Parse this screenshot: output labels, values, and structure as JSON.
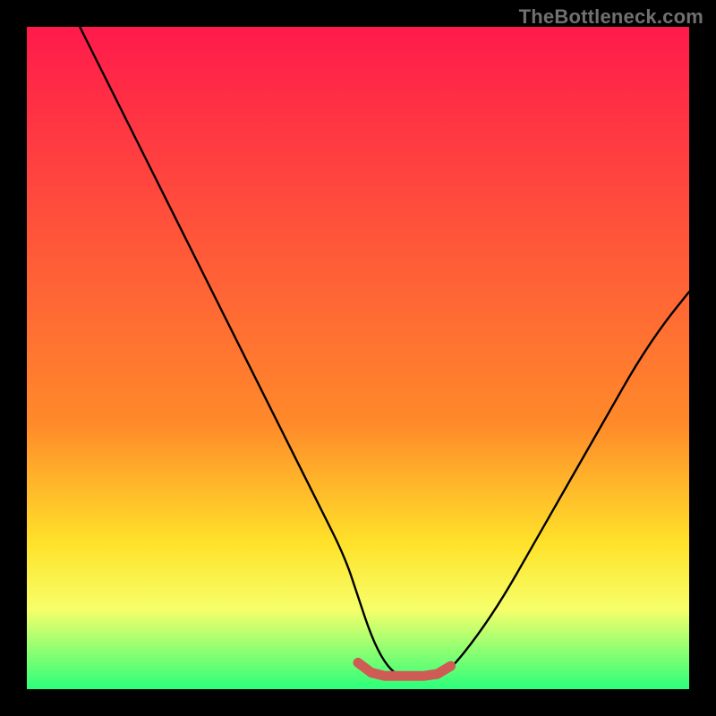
{
  "watermark": {
    "text": "TheBottleneck.com"
  },
  "colors": {
    "gradient_top": "#ff1a4b",
    "gradient_mid1": "#ff8a2a",
    "gradient_mid2": "#ffe22a",
    "gradient_mid3": "#f6ff6a",
    "gradient_bottom": "#2bff7a",
    "curve": "#000000",
    "marker": "#cf5b55",
    "frame": "#000000"
  },
  "chart_data": {
    "type": "line",
    "title": "",
    "xlabel": "",
    "ylabel": "",
    "xlim": [
      0,
      100
    ],
    "ylim": [
      0,
      100
    ],
    "series": [
      {
        "name": "bottleneck-curve",
        "x": [
          8,
          12,
          16,
          20,
          24,
          28,
          32,
          36,
          40,
          44,
          48,
          50,
          52,
          54,
          56,
          58,
          60,
          62,
          64,
          68,
          72,
          76,
          80,
          84,
          88,
          92,
          96,
          100
        ],
        "y": [
          100,
          92,
          84,
          76,
          68,
          60,
          52,
          44,
          36,
          28,
          20,
          14,
          8,
          4,
          2,
          2,
          2,
          2,
          3,
          8,
          14,
          21,
          28,
          35,
          42,
          49,
          55,
          60
        ]
      }
    ],
    "marker": {
      "name": "optimal-range",
      "x": [
        50,
        52,
        54,
        56,
        58,
        60,
        62,
        64
      ],
      "y": [
        4,
        2.5,
        2,
        2,
        2,
        2,
        2.3,
        3.5
      ]
    },
    "gradient_bands_percent": [
      0,
      60,
      78,
      88,
      94,
      100
    ]
  }
}
